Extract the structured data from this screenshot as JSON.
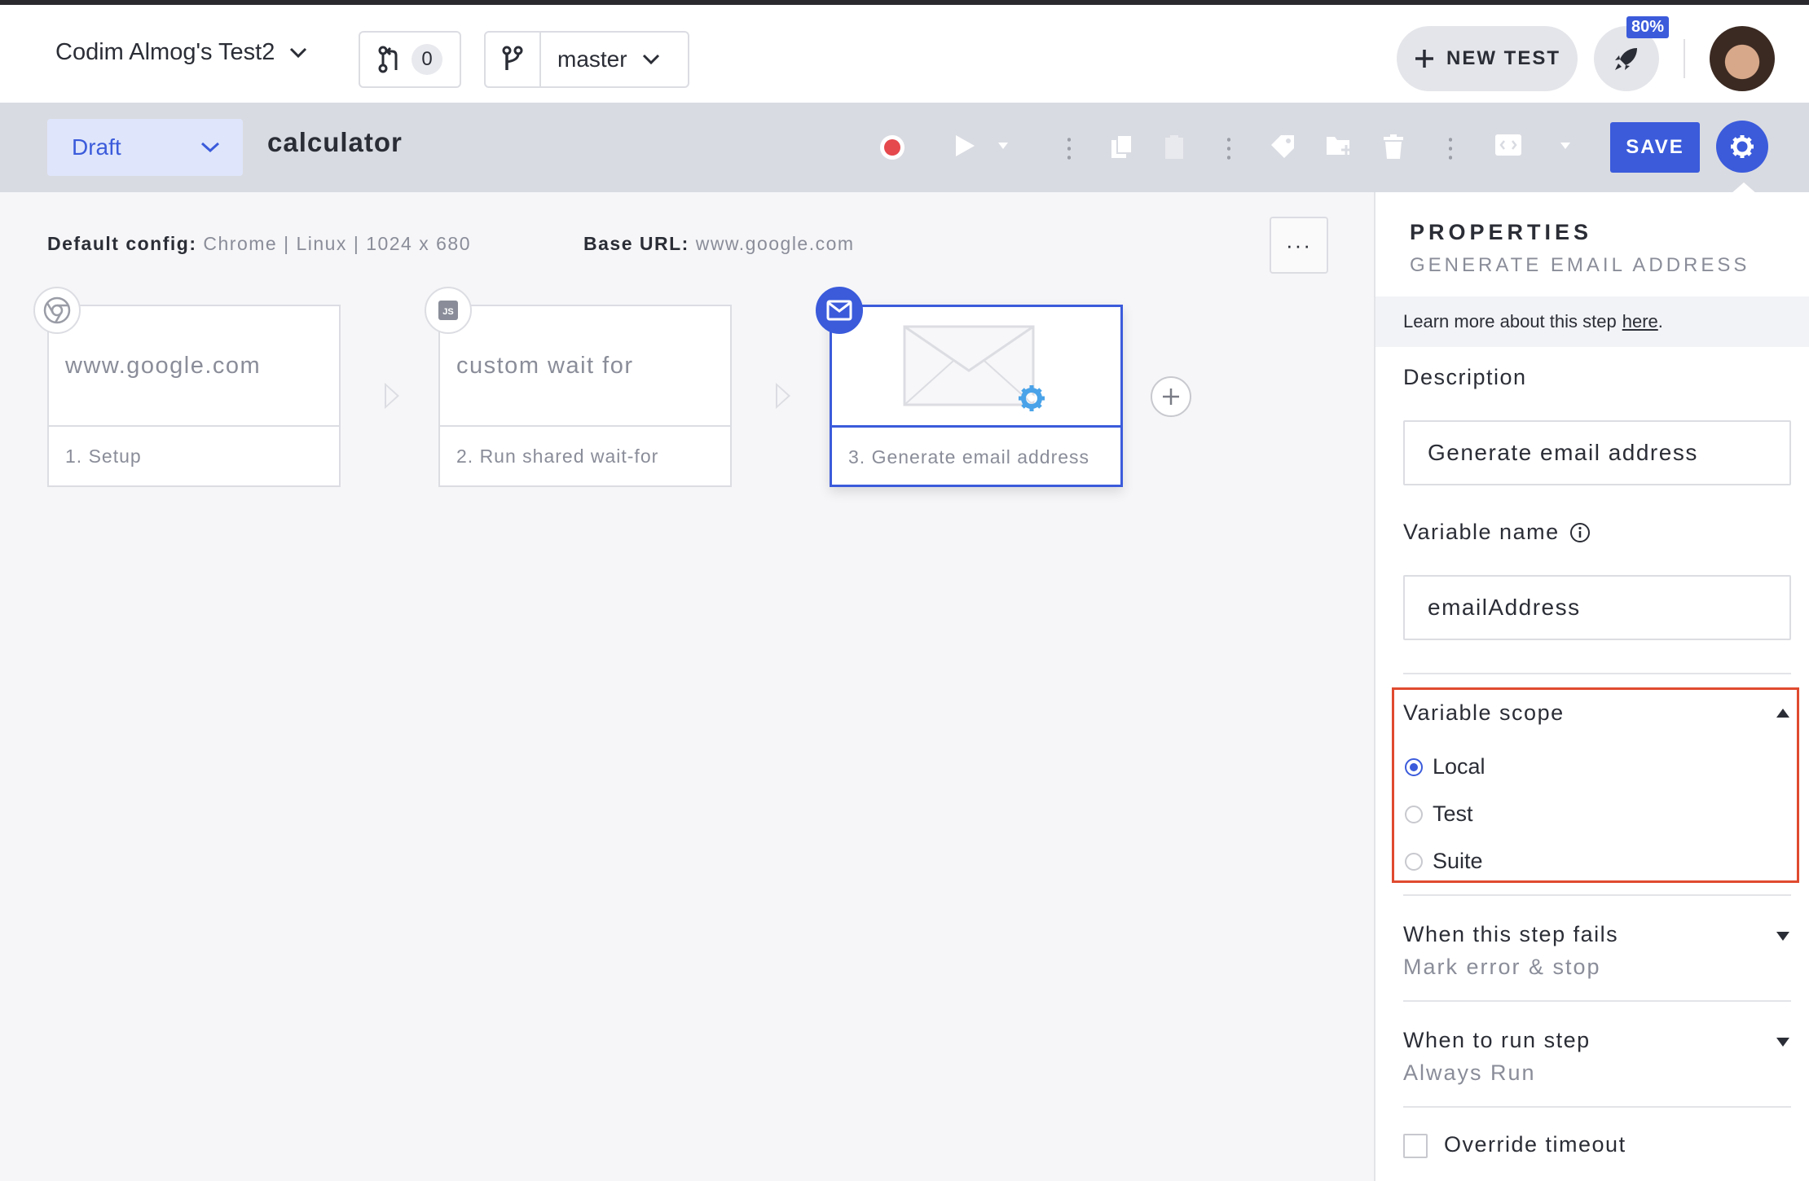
{
  "header": {
    "project_name": "Codim Almog's Test2",
    "pr_count": "0",
    "branch": "master",
    "new_test_label": "NEW TEST",
    "progress_badge": "80%"
  },
  "toolbar": {
    "status": "Draft",
    "test_name": "calculator",
    "save_label": "SAVE",
    "accent_color": "#3b5bdb"
  },
  "canvas": {
    "config_label": "Default config:",
    "config_value": "Chrome | Linux | 1024 x 680",
    "base_url_label": "Base URL:",
    "base_url_value": "www.google.com",
    "more_label": "···",
    "steps": [
      {
        "title": "www.google.com",
        "caption": "1. Setup",
        "icon": "chrome-icon"
      },
      {
        "title": "custom wait for",
        "caption": "2. Run shared wait-for",
        "icon": "js-icon"
      },
      {
        "title": "",
        "caption": "3. Generate email address",
        "icon": "email-icon"
      }
    ]
  },
  "properties": {
    "title": "PROPERTIES",
    "subtitle": "GENERATE EMAIL ADDRESS",
    "learn_text": "Learn more about this step",
    "learn_link": "here",
    "learn_period": ".",
    "description_label": "Description",
    "description_value": "Generate email address",
    "variable_name_label": "Variable name",
    "variable_name_value": "emailAddress",
    "variable_scope_label": "Variable scope",
    "scope_options": [
      "Local",
      "Test",
      "Suite"
    ],
    "scope_selected": "Local",
    "on_fail_label": "When this step fails",
    "on_fail_value": "Mark error & stop",
    "when_run_label": "When to run step",
    "when_run_value": "Always Run",
    "override_timeout_label": "Override timeout"
  }
}
